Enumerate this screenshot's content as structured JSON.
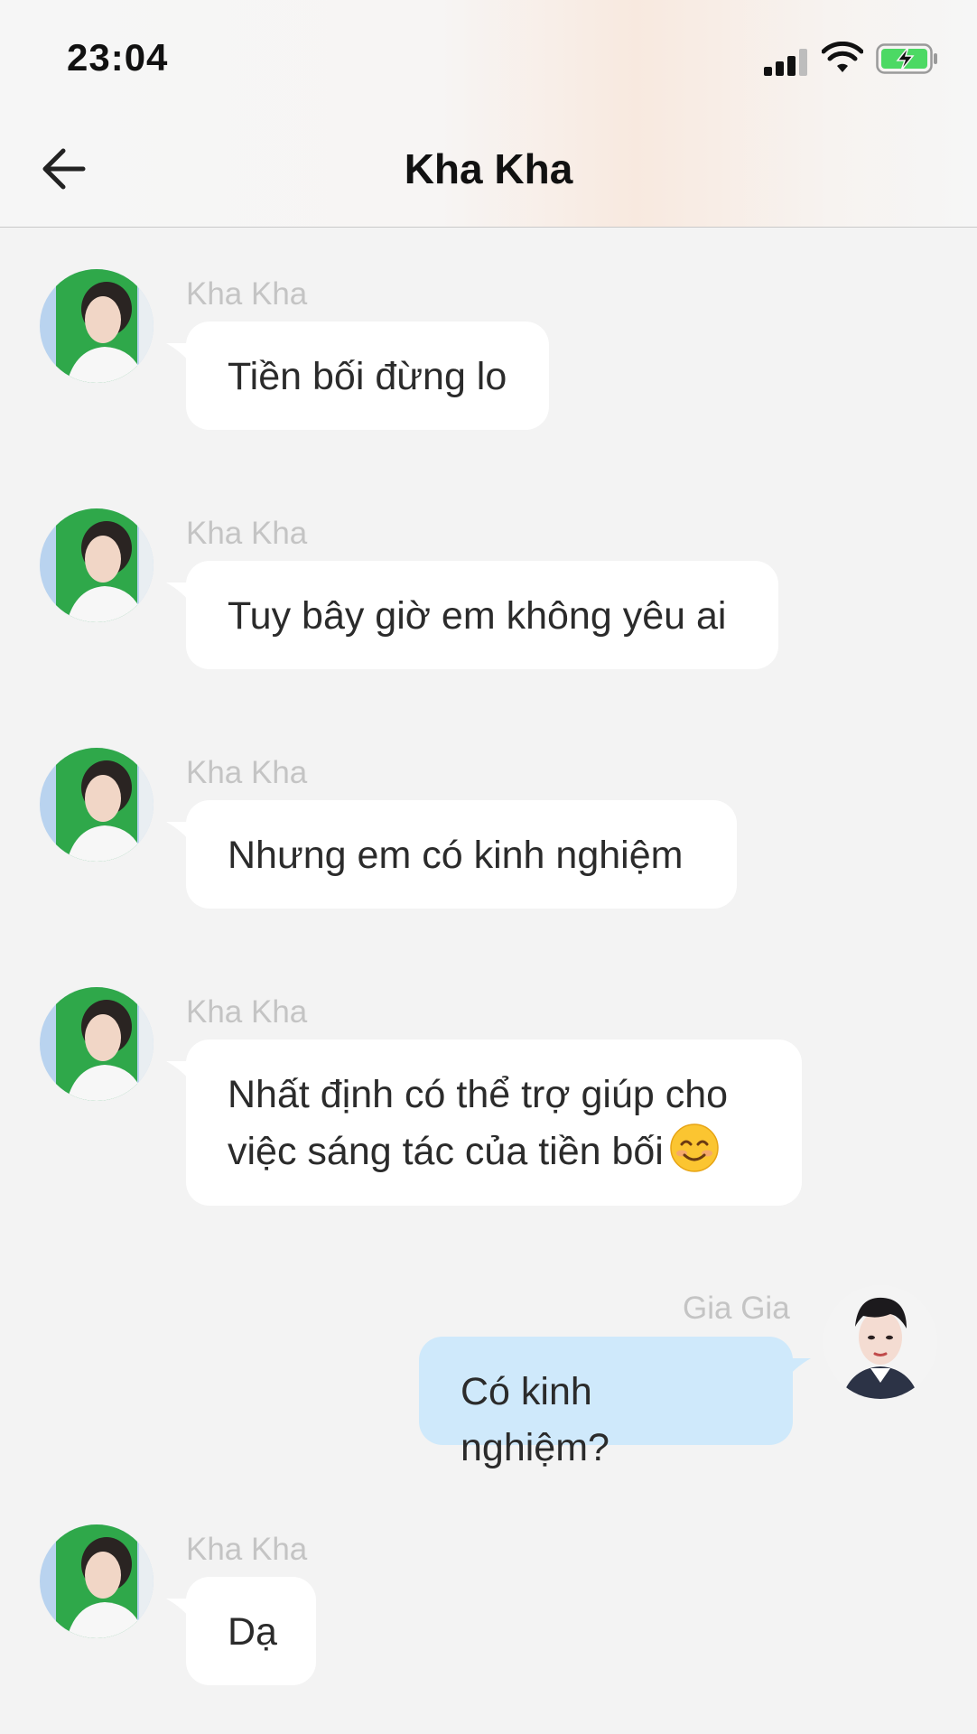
{
  "status_bar": {
    "time": "23:04"
  },
  "header": {
    "title": "Kha Kha",
    "back_icon": "arrow-left-icon"
  },
  "messages": [
    {
      "sender": "Kha Kha",
      "text": "Tiền bối đừng lo",
      "direction": "in"
    },
    {
      "sender": "Kha Kha",
      "text": "Tuy bây giờ em không yêu ai",
      "direction": "in"
    },
    {
      "sender": "Kha Kha",
      "text": "Nhưng em có kinh nghiệm",
      "direction": "in"
    },
    {
      "sender": "Kha Kha",
      "line1": "Nhất định có thể trợ giúp cho",
      "line2": "việc sáng tác của tiền bối",
      "emoji": "smiling-face-emoji",
      "direction": "in"
    },
    {
      "sender": "Gia Gia",
      "text": "Có kinh nghiệm?",
      "direction": "out"
    },
    {
      "sender": "Kha Kha",
      "text": "Dạ",
      "direction": "in"
    }
  ],
  "colors": {
    "incoming_bubble": "#ffffff",
    "outgoing_bubble": "#cfe9fb",
    "background": "#f3f3f3",
    "sender_name": "#c4c4c4"
  }
}
